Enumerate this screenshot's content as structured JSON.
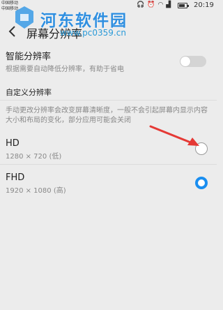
{
  "status_bar": {
    "carrier_1": "中国移动",
    "carrier_2": "中国移动",
    "time": "20:19",
    "battery_level": 0.8
  },
  "header": {
    "title": "屏幕分辨率"
  },
  "watermark": {
    "name": "河东软件园",
    "url": "www.pc0359.cn"
  },
  "smart_resolution": {
    "title": "智能分辨率",
    "description": "根据需要自动降低分辨率，有助于省电",
    "enabled": false
  },
  "custom": {
    "section_title": "自定义分辨率",
    "description": "手动更改分辨率会改变屏幕清晰度，一般不会引起屏幕内显示内容大小和布局的变化，部分应用可能会关闭"
  },
  "options": [
    {
      "label": "HD",
      "detail": "1280 × 720 (低)",
      "selected": false
    },
    {
      "label": "FHD",
      "detail": "1920 × 1080 (高)",
      "selected": true
    }
  ],
  "colors": {
    "accent": "#1a8ef0",
    "annotation_arrow": "#e53935",
    "watermark": "#2f8fe0"
  }
}
